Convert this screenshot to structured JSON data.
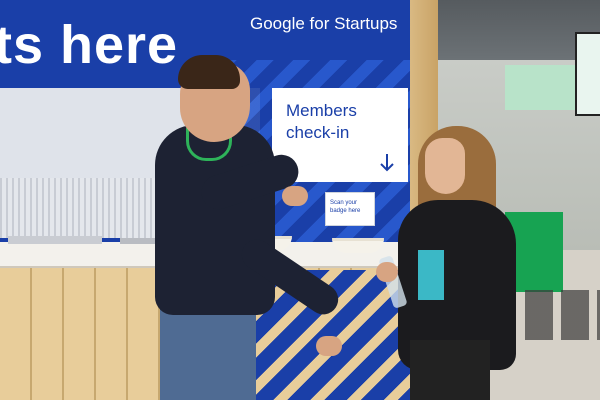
{
  "booth": {
    "headline": "ts here",
    "brand": "Google for Startups",
    "members_sign": "Members\ncheck-in",
    "scan_sign": "Scan your\nbadge here"
  },
  "colors": {
    "booth_blue": "#1a3fa8",
    "stripe_blue": "#2a5bd0",
    "wood": "#e8cd9a",
    "green_wall": "#17a352"
  },
  "icons": {
    "members_arrow": "arrow-down-icon"
  }
}
